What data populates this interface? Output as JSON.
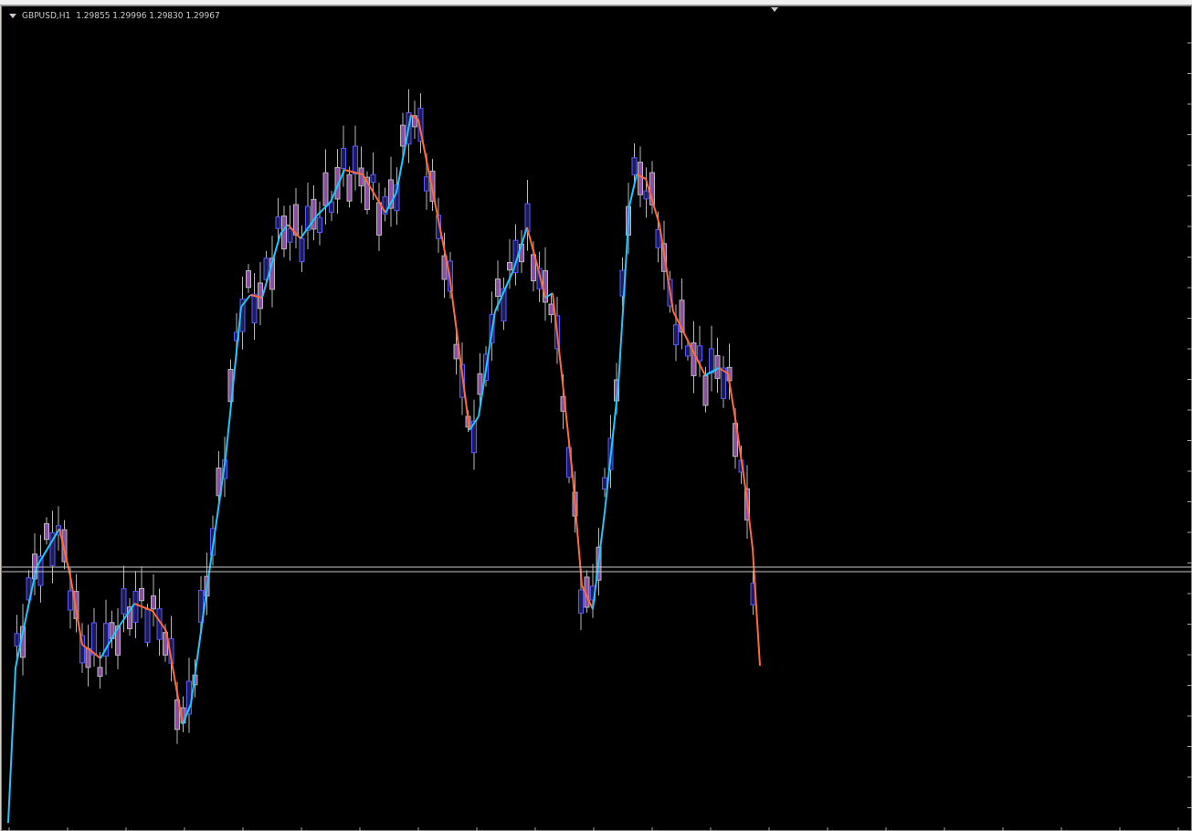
{
  "chart": {
    "symbol": "GBPUSD,H1",
    "quote": "1.29855 1.29996 1.29830 1.29967"
  }
}
